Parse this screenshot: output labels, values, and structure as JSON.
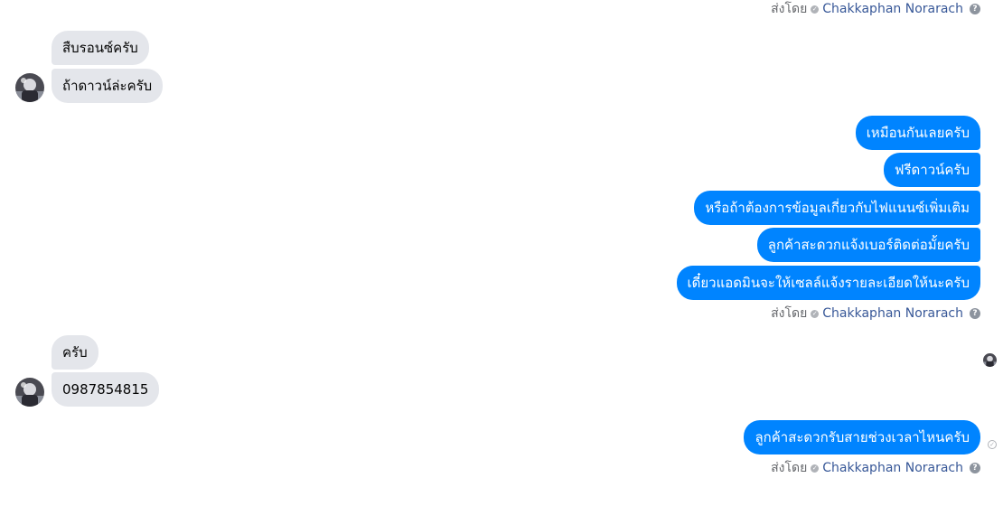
{
  "sent_by_label": "ส่งโดย",
  "sender_name": "Chakkaphan Norarach",
  "colors": {
    "incoming_bubble": "#e4e6eb",
    "outgoing_bubble": "#0084ff",
    "sender_link": "#385898",
    "meta_text": "#65676b"
  },
  "icons": {
    "verified": "check-circle-icon",
    "help": "question-circle-icon",
    "sent_status": "sent-check-icon"
  },
  "conversation": {
    "group1_incoming": [
      "สืบรอนซ์ครับ",
      "ถ้าดาวน์ล่ะครับ"
    ],
    "group2_outgoing": [
      "เหมือนกันเลยครับ",
      "ฟรีดาวน์ครับ",
      "หรือถ้าต้องการข้อมูลเกี่ยวกับไฟแนนซ์เพิ่มเติม",
      "ลูกค้าสะดวกแจ้งเบอร์ติดต่อมั้ยครับ",
      "เดี๋ยวแอดมินจะให้เซลล์แจ้งรายละเอียดให้นะครับ"
    ],
    "group3_incoming": [
      "ครับ",
      "0987854815"
    ],
    "group4_outgoing": [
      "ลูกค้าสะดวกรับสายช่วงเวลาไหนครับ"
    ]
  }
}
